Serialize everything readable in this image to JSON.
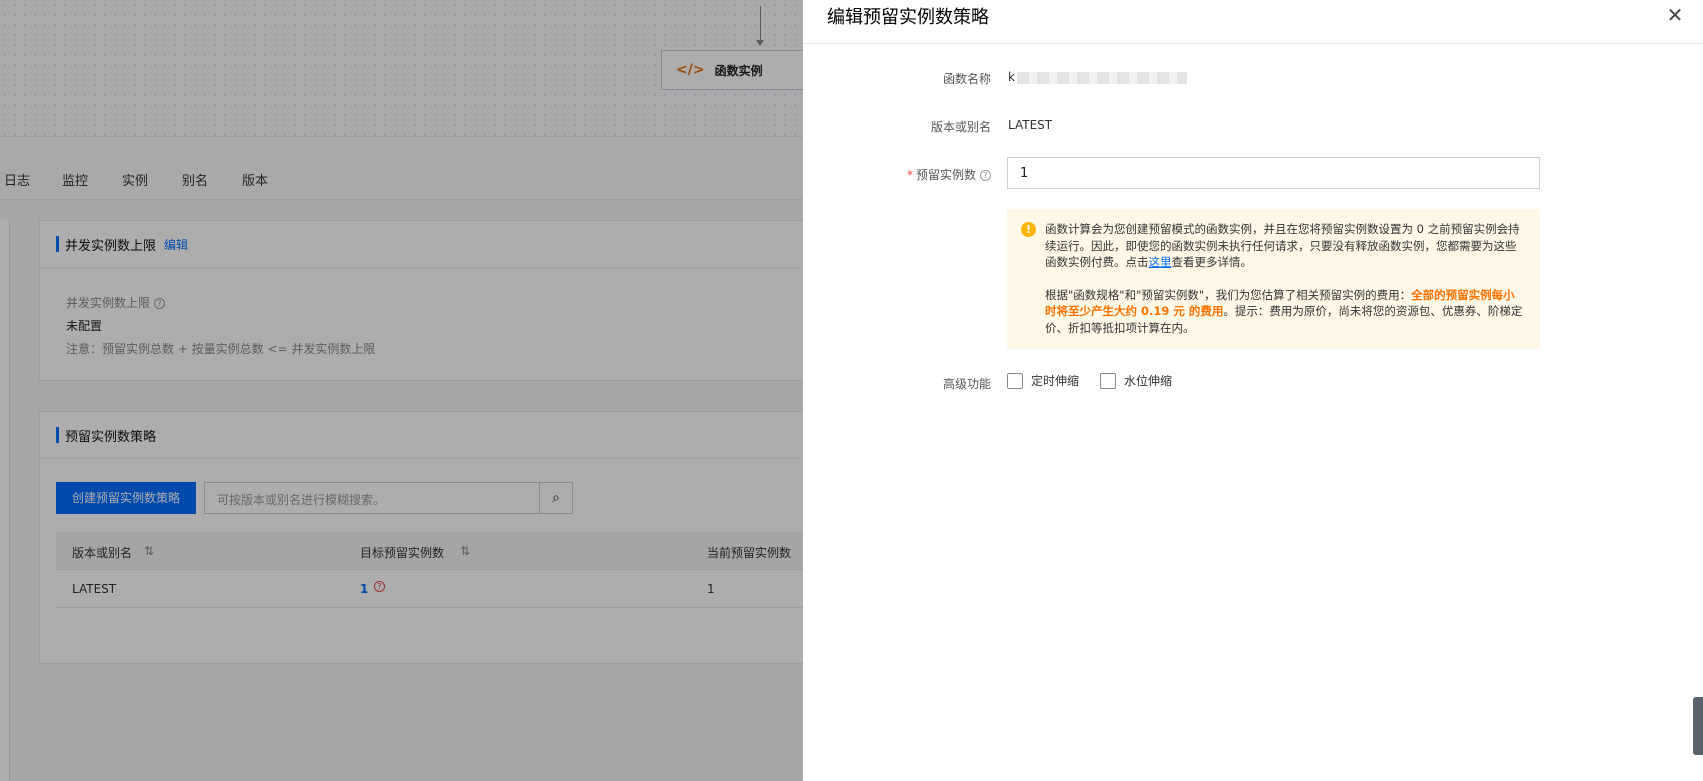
{
  "flow": {
    "node_label": "函数实例",
    "node_icon": "code-icon"
  },
  "tabs": [
    "日志",
    "监控",
    "实例",
    "别名",
    "版本"
  ],
  "concurrency_panel": {
    "title": "并发实例数上限",
    "edit_link": "编辑",
    "label": "并发实例数上限",
    "value": "未配置",
    "note": "注意：预留实例总数 + 按量实例总数 <= 并发实例数上限"
  },
  "provisioned_panel": {
    "title": "预留实例数策略",
    "create_button": "创建预留实例数策略",
    "search_placeholder": "可按版本或别名进行模糊搜索。",
    "columns": [
      "版本或别名",
      "目标预留实例数",
      "当前预留实例数"
    ],
    "rows": [
      {
        "version": "LATEST",
        "target": "1",
        "current": "1"
      }
    ]
  },
  "drawer": {
    "title": "编辑预留实例数策略",
    "fields": {
      "function_name_label": "函数名称",
      "function_name_value": "k",
      "version_label": "版本或别名",
      "version_value": "LATEST",
      "count_label": "预留实例数",
      "count_value": "1",
      "advanced_label": "高级功能"
    },
    "notice": {
      "p1_before": "函数计算会为您创建预留模式的函数实例，并且在您将预留实例数设置为 0 之前预留实例会持续运行。因此，即使您的函数实例未执行任何请求，只要没有释放函数实例，您都需要为这些函数实例付费。点击",
      "p1_link": "这里",
      "p1_after": "查看更多详情。",
      "p2_before": "根据\"函数规格\"和\"预留实例数\"，我们为您估算了相关预留实例的费用：",
      "p2_warn": "全部的预留实例每小时将至少产生大约 0.19 元 的费用",
      "p2_after": "。提示：费用为原价，尚未将您的资源包、优惠券、阶梯定价、折扣等抵扣项计算在内。"
    },
    "options": {
      "scheduled": "定时伸缩",
      "watermark": "水位伸缩"
    }
  },
  "colors": {
    "accent": "#006eff",
    "warning": "#ff7200",
    "notice_bg": "#fff8e6"
  }
}
